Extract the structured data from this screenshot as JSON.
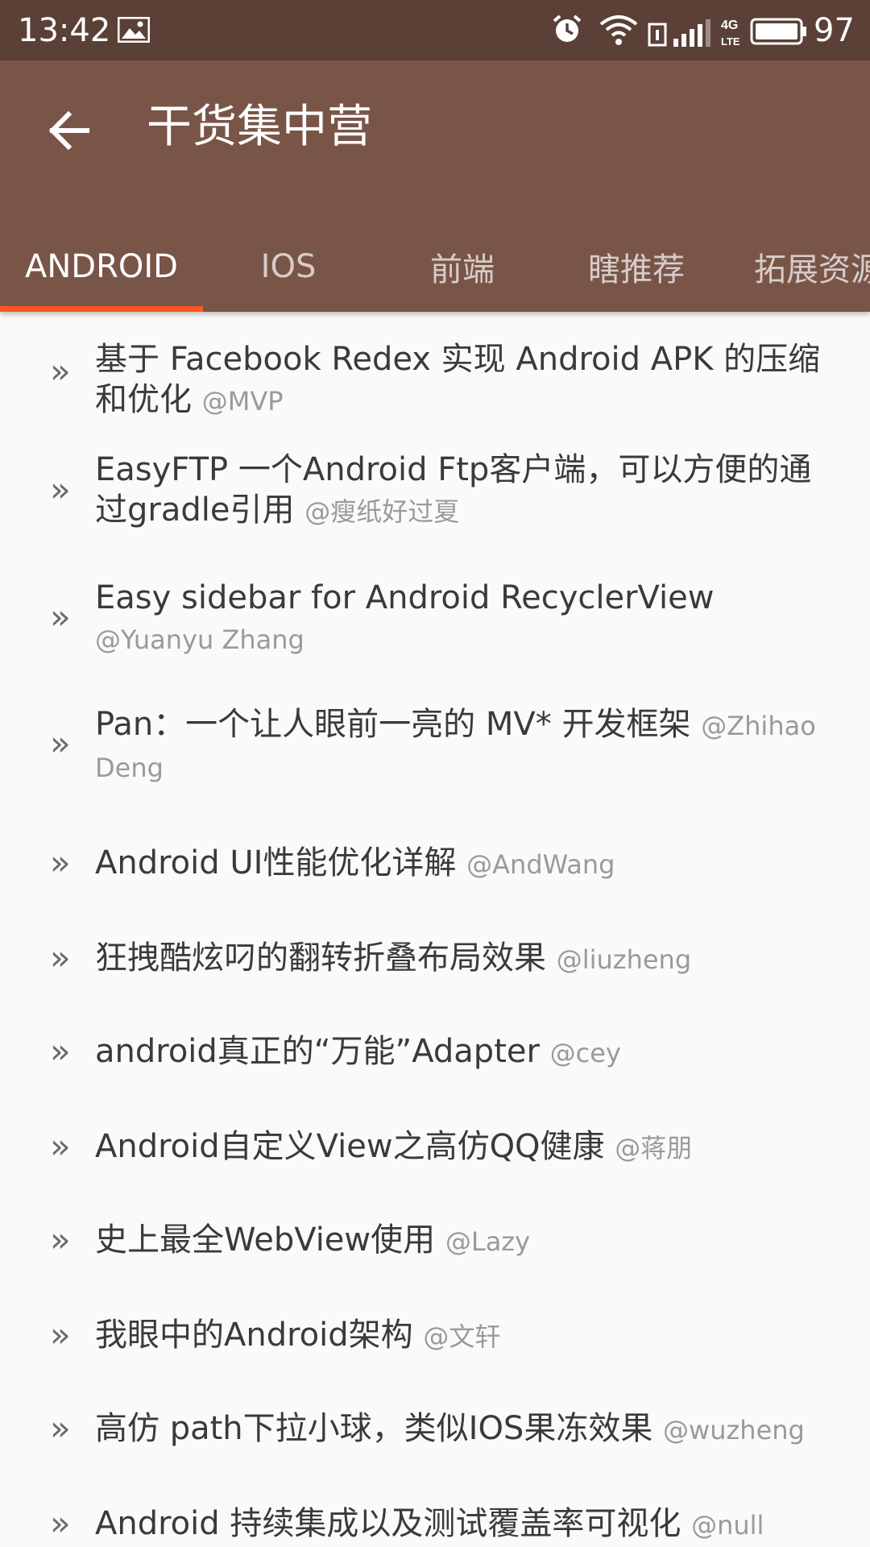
{
  "status_bar": {
    "time": "13:42",
    "battery": "97",
    "icons": [
      "image-icon",
      "alarm-icon",
      "wifi-icon",
      "sim-icon",
      "signal-icon",
      "4g-lte-icon",
      "battery-icon"
    ]
  },
  "app_bar": {
    "title": "干货集中营",
    "back_icon": "arrow-back-icon"
  },
  "tabs": [
    {
      "label": "ANDROID",
      "active": true
    },
    {
      "label": "IOS",
      "active": false
    },
    {
      "label": "前端",
      "active": false
    },
    {
      "label": "瞎推荐",
      "active": false
    },
    {
      "label": "拓展资源",
      "active": false
    }
  ],
  "colors": {
    "status_bar": "#5b4037",
    "app_bar": "#795548",
    "indicator": "#ff5722",
    "background": "#fafafa"
  },
  "list": {
    "bullet": "»",
    "items": [
      {
        "title": "基于 Facebook Redex 实现 Android APK 的压缩和优化",
        "author": "@MVP"
      },
      {
        "title": "EasyFTP 一个Android Ftp客户端，可以方便的通过gradle引用",
        "author": "@瘦纸好过夏"
      },
      {
        "title": "Easy sidebar for Android RecyclerView",
        "author": "@Yuanyu Zhang"
      },
      {
        "title": "Pan：一个让人眼前一亮的 MV* 开发框架",
        "author": "@Zhihao Deng"
      },
      {
        "title": "Android UI性能优化详解",
        "author": "@AndWang"
      },
      {
        "title": "狂拽酷炫叼的翻转折叠布局效果",
        "author": "@liuzheng"
      },
      {
        "title": "android真正的“万能”Adapter",
        "author": "@cey"
      },
      {
        "title": "Android自定义View之高仿QQ健康",
        "author": "@蒋朋"
      },
      {
        "title": "史上最全WebView使用",
        "author": "@Lazy"
      },
      {
        "title": "我眼中的Android架构",
        "author": "@文轩"
      },
      {
        "title": "高仿 path下拉小球，类似IOS果冻效果",
        "author": "@wuzheng"
      },
      {
        "title": "Android 持续集成以及测试覆盖率可视化",
        "author": "@null"
      }
    ]
  }
}
